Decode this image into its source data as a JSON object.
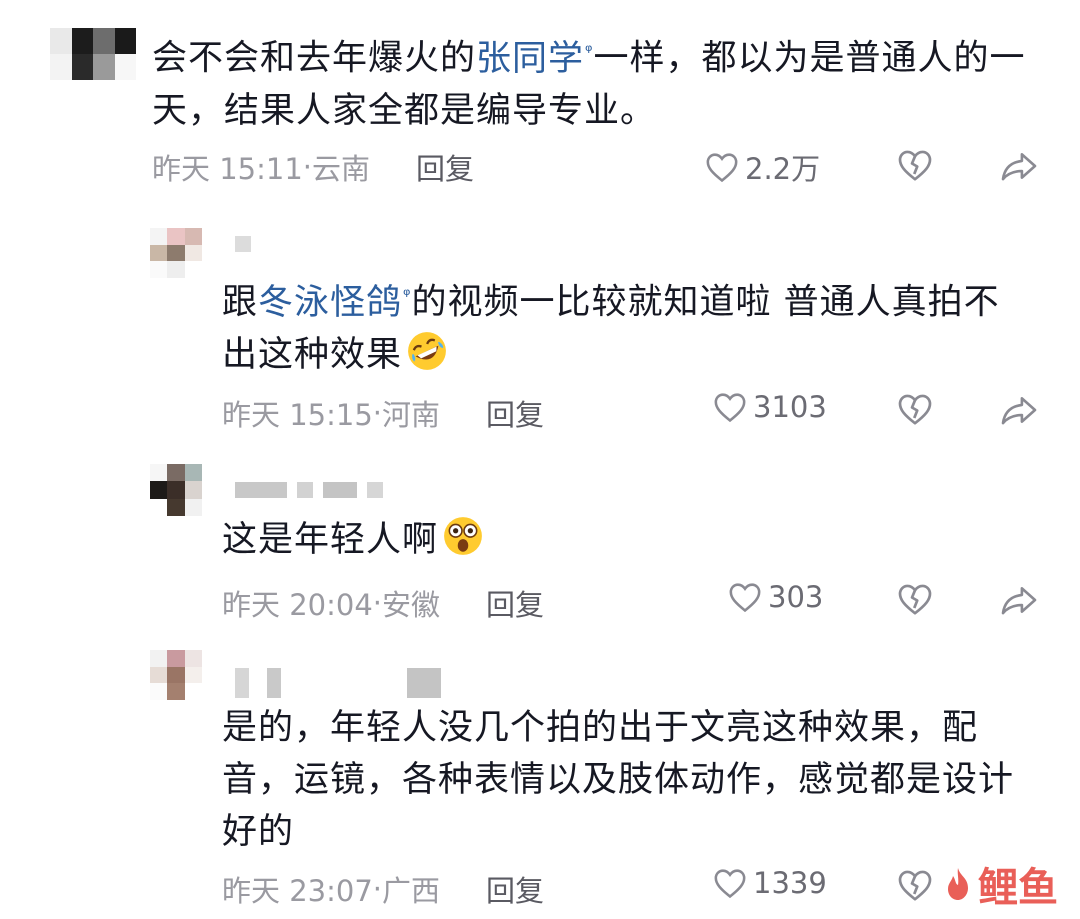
{
  "comments": [
    {
      "text_before": "会不会和去年爆火的",
      "link": "张同学",
      "text_after": "一样，都以为是普通人的一天，结果人家全都是编导专业。",
      "time": "昨天 15:11",
      "location": "云南",
      "reply_label": "回复",
      "likes": "2.2万"
    },
    {
      "text_before": "跟",
      "link": "冬泳怪鸽",
      "text_after": "的视频一比较就知道啦 普通人真拍不出这种效果",
      "emoji": "rofl-emoji",
      "time": "昨天 15:15",
      "location": "河南",
      "reply_label": "回复",
      "likes": "3103"
    },
    {
      "text": "这是年轻人啊",
      "emoji": "astonished-emoji",
      "time": "昨天 20:04",
      "location": "安徽",
      "reply_label": "回复",
      "likes": "303"
    },
    {
      "text": "是的，年轻人没几个拍的出于文亮这种效果，配音，运镜，各种表情以及肢体动作，感觉都是设计好的",
      "time": "昨天 23:07",
      "location": "广西",
      "reply_label": "回复",
      "likes": "1339"
    }
  ],
  "search_glyph": "ᵠ",
  "location_separator": "·",
  "watermark": "鲤鱼",
  "colors": {
    "link": "#2c5e9e",
    "meta": "#9a9aa1",
    "text": "#161823",
    "watermark": "#e6443c"
  }
}
